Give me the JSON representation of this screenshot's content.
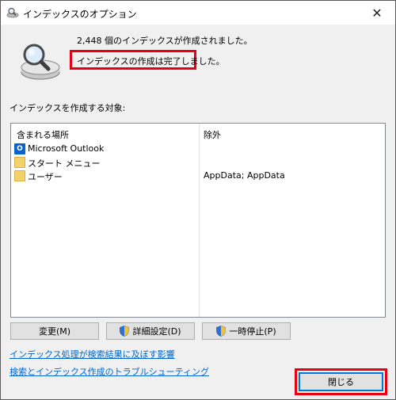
{
  "window": {
    "title": "インデックスのオプション",
    "close_glyph": "✕"
  },
  "summary": {
    "count_text": "2,448 個のインデックスが作成されました。",
    "status_text": "インデックスの作成は完了しました。"
  },
  "section_label": "インデックスを作成する対象:",
  "list": {
    "col_location": "含まれる場所",
    "col_exclude": "除外",
    "rows": [
      {
        "name": "Microsoft Outlook",
        "exclude": "",
        "icon": "outlook-icon"
      },
      {
        "name": "スタート メニュー",
        "exclude": "",
        "icon": "folder-icon"
      },
      {
        "name": "ユーザー",
        "exclude": "AppData; AppData",
        "icon": "folder-icon"
      }
    ]
  },
  "buttons": {
    "modify": "変更(M)",
    "advanced": "詳細設定(D)",
    "pause": "一時停止(P)",
    "close": "閉じる"
  },
  "links": {
    "affect": "インデックス処理が検索結果に及ぼす影響",
    "troubleshoot": "検索とインデックス作成のトラブルシューティング"
  },
  "colors": {
    "highlight_red": "#e60012",
    "link_blue": "#0066cc",
    "outlook_blue": "#0a64c8",
    "folder_yellow": "#f4d26b"
  }
}
